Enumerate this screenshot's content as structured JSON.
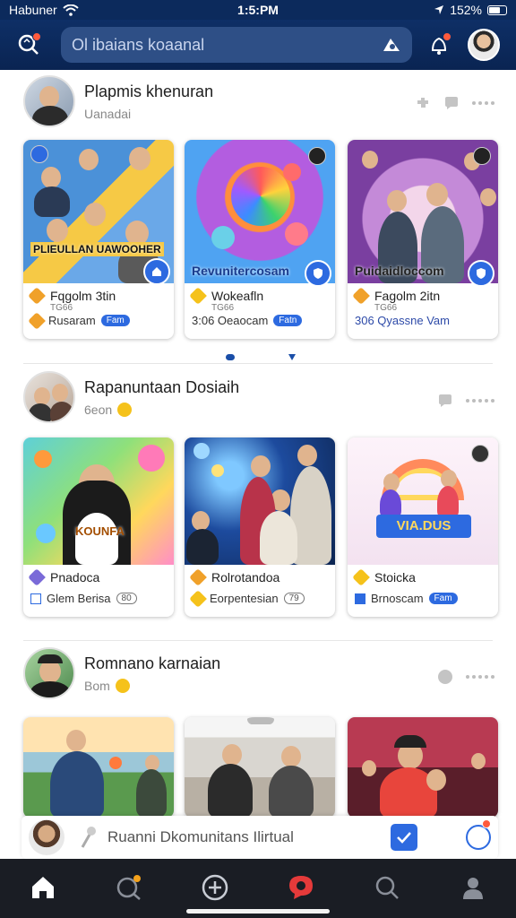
{
  "status_bar": {
    "carrier": "Habuner",
    "time": "1:5:PM",
    "battery": "152%"
  },
  "header": {
    "search_placeholder": "Ol ibaians koaanal"
  },
  "sections": [
    {
      "title": "Plapmis khenuran",
      "subtitle": "Uanadai",
      "cards": [
        {
          "thumb_title": "PLIEULLAN UAWOOHER",
          "line1": "Fqgolm 3tin",
          "meta": "TG66",
          "line2": "Rusaram",
          "pill": "Fam"
        },
        {
          "thumb_title": "Revunitercosam",
          "line1": "Wokeafln",
          "meta": "TG66",
          "line2": "3:06 Oeaocam",
          "pill": "Fatn"
        },
        {
          "thumb_title": "Puidaidloccom",
          "line1": "Fagolm 2itn",
          "meta": "TG66",
          "line2": "306 Qyassne Vam",
          "pill": ""
        }
      ]
    },
    {
      "title": "Rapanuntaan Dosiaih",
      "subtitle": "6eon",
      "cards": [
        {
          "thumb_title": "KOUNFA",
          "line1": "Pnadoca",
          "line2": "Glem Berisa",
          "pill": "80"
        },
        {
          "thumb_title": "",
          "line1": "Rolrotandoa",
          "line2": "Eorpentesian",
          "pill": "79"
        },
        {
          "thumb_title": "VIA.DUS",
          "line1": "Stoicka",
          "line2": "Brnoscam",
          "pill": "Fam"
        }
      ]
    },
    {
      "title": "Romnano karnaian",
      "subtitle": "Bom",
      "cards": [
        {},
        {},
        {}
      ]
    }
  ],
  "mini_player": {
    "title": "Ruanni Dkomunitans Ilirtual"
  },
  "tabs": [
    "home",
    "explore",
    "create",
    "notifications",
    "search",
    "profile"
  ]
}
